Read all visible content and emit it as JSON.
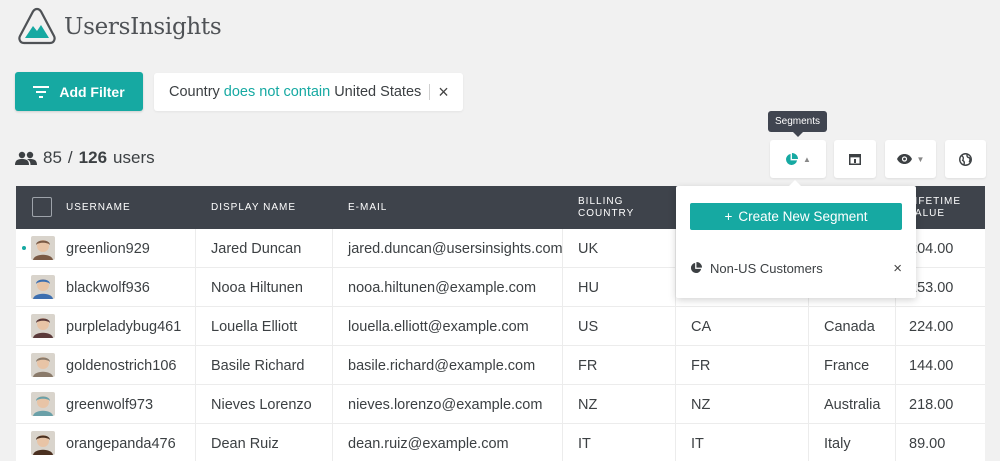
{
  "app": {
    "name": "UsersInsights"
  },
  "toolbar": {
    "add_filter_label": "Add Filter",
    "filter": {
      "field": "Country",
      "operator": "does not contain",
      "value": "United States"
    }
  },
  "summary": {
    "filtered": "85",
    "sep": "/",
    "total": "126",
    "unit": "users"
  },
  "tooltip": {
    "segments": "Segments"
  },
  "segments_menu": {
    "create_label": "Create New Segment",
    "items": [
      {
        "name": "Non-US Customers"
      }
    ]
  },
  "table": {
    "columns": [
      {
        "label": "USERNAME"
      },
      {
        "label": "DISPLAY NAME"
      },
      {
        "label": "E-MAIL"
      },
      {
        "label": "BILLING COUNTRY"
      },
      {
        "label": "LIFETIME VALUE"
      }
    ],
    "rows": [
      {
        "username": "greenlion929",
        "display": "Jared Duncan",
        "email": "jared.duncan@usersinsights.com",
        "billing": "UK",
        "c5": "",
        "c6": "",
        "value": "204.00",
        "online": true,
        "avatar_color": "#7a5a45"
      },
      {
        "username": "blackwolf936",
        "display": "Nooa Hiltunen",
        "email": "nooa.hiltunen@example.com",
        "billing": "HU",
        "c5": "",
        "c6": "",
        "value": "253.00",
        "online": false,
        "avatar_color": "#3d6fb0"
      },
      {
        "username": "purpleladybug461",
        "display": "Louella Elliott",
        "email": "louella.elliott@example.com",
        "billing": "US",
        "c5": "CA",
        "c6": "Canada",
        "value": "224.00",
        "online": false,
        "avatar_color": "#5b3a3a"
      },
      {
        "username": "goldenostrich106",
        "display": "Basile Richard",
        "email": "basile.richard@example.com",
        "billing": "FR",
        "c5": "FR",
        "c6": "France",
        "value": "144.00",
        "online": false,
        "avatar_color": "#8a7a6a"
      },
      {
        "username": "greenwolf973",
        "display": "Nieves Lorenzo",
        "email": "nieves.lorenzo@example.com",
        "billing": "NZ",
        "c5": "NZ",
        "c6": "Australia",
        "value": "218.00",
        "online": false,
        "avatar_color": "#6aa0a8"
      },
      {
        "username": "orangepanda476",
        "display": "Dean Ruiz",
        "email": "dean.ruiz@example.com",
        "billing": "IT",
        "c5": "IT",
        "c6": "Italy",
        "value": "89.00",
        "online": false,
        "avatar_color": "#4a3020"
      }
    ]
  },
  "colors": {
    "accent": "#16a9a2",
    "header_bg": "#3e434b",
    "page_bg": "#f1f1f1"
  }
}
